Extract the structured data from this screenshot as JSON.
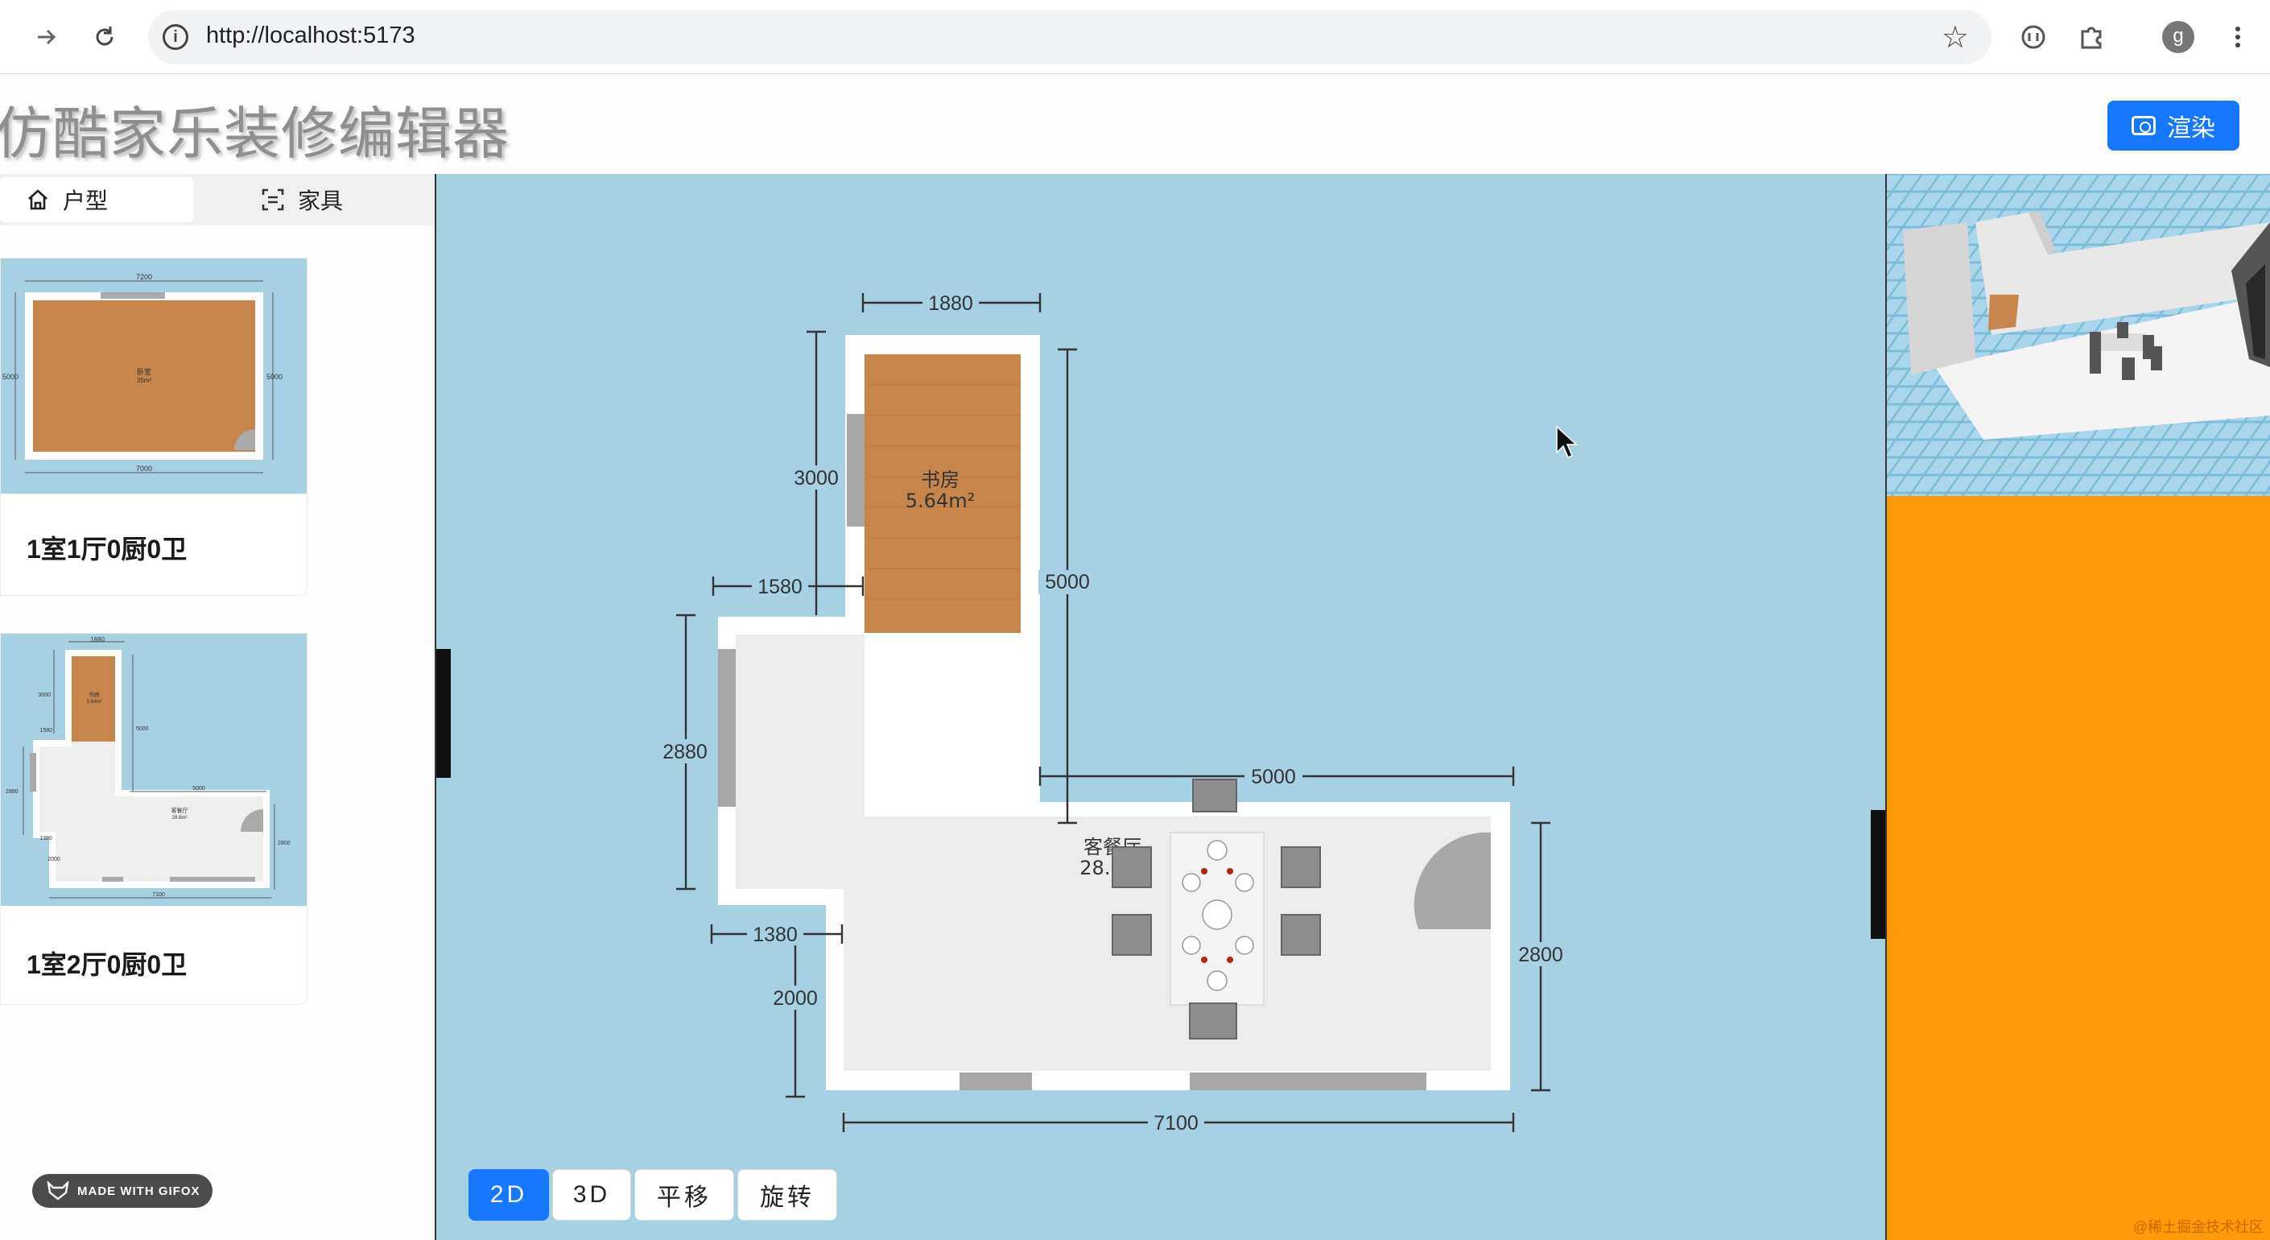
{
  "browser": {
    "url": "http://localhost:5173",
    "avatar_letter": "g"
  },
  "header": {
    "title": "仿酷家乐装修编辑器",
    "render_label": "渲染",
    "accent": "#1677ff"
  },
  "sidebar": {
    "tabs": [
      {
        "label": "户型",
        "icon": "home-icon"
      },
      {
        "label": "家具",
        "icon": "scan-icon"
      }
    ],
    "plans": [
      {
        "label": "1室1厅0厨0卫",
        "thumb_dims": [
          "7200",
          "5000",
          "5000",
          "7000"
        ],
        "room_name": "卧室",
        "room_area": "35m²"
      },
      {
        "label": "1室2厅0厨0卫",
        "thumb_dims": [
          "1880",
          "3000",
          "1580",
          "5000",
          "2880",
          "5000",
          "1380",
          "2000",
          "2800",
          "7100"
        ],
        "room_name": "书房",
        "room_area": "5.64m²",
        "room2_name": "客餐厅",
        "room2_area": "28.8m²"
      }
    ],
    "badge": "MADE WITH GIFOX"
  },
  "canvas": {
    "background": "#a6d1e2",
    "rooms": [
      {
        "name": "书房",
        "area": "5.64m²"
      },
      {
        "name": "客餐厅",
        "area": "28.8"
      }
    ],
    "dimensions": {
      "top": "1880",
      "study_height": "3000",
      "left_step": "1580",
      "right_height": "5000",
      "left_height": "2880",
      "living_width": "5000",
      "bottom_step": "1380",
      "bottom_left": "2000",
      "right_small": "2800",
      "bottom_total": "7100"
    },
    "modes": [
      {
        "label": "2D",
        "active": true
      },
      {
        "label": "3D",
        "active": false
      },
      {
        "label": "平移",
        "active": false
      },
      {
        "label": "旋转",
        "active": false
      }
    ]
  },
  "preview": {
    "background": "#ff9a08",
    "watermark": "@稀土掘金技术社区"
  }
}
